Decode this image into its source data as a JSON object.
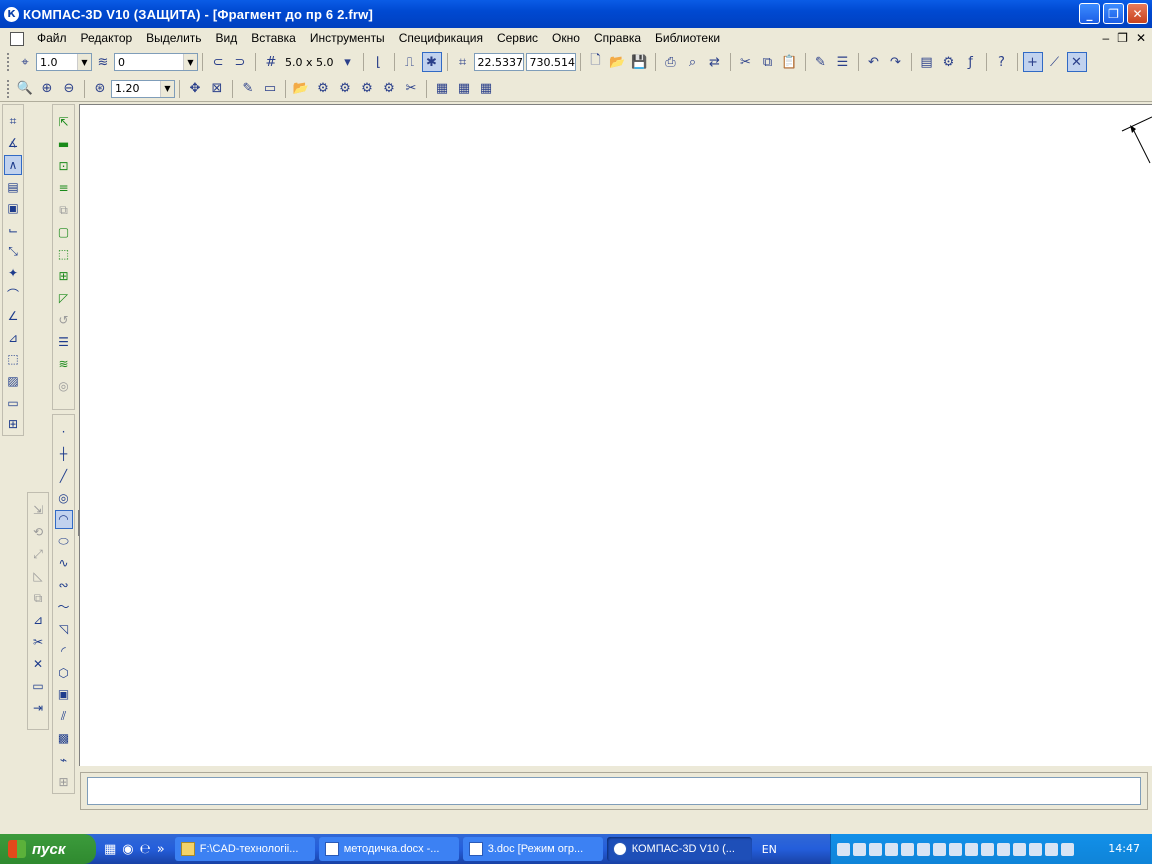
{
  "window": {
    "title": "КОМПАС-3D V10 (ЗАЩИТА) - [Фрагмент до пр 6  2.frw]"
  },
  "menu": [
    "Файл",
    "Редактор",
    "Выделить",
    "Вид",
    "Вставка",
    "Инструменты",
    "Спецификация",
    "Сервис",
    "Окно",
    "Справка",
    "Библиотеки"
  ],
  "toolbar1": {
    "line_scale": "1.0",
    "layer": "0",
    "grid_step": "5.0 x 5.0",
    "coord_x": "22.5337",
    "coord_y": "730.514"
  },
  "toolbar2": {
    "zoom": "1.20"
  },
  "taskbar": {
    "start_label": "пуск",
    "tasks": [
      "F:\\CAD-технологii...",
      "методичка.docx -...",
      "3.doc [Режим огр...",
      "КОМПАС-3D V10 (..."
    ],
    "lang": "EN",
    "clock": "14:47"
  },
  "icons": {
    "flyout": [
      "arc-1",
      "arc-2",
      "arc-3",
      "arc-4",
      "arc-5"
    ]
  }
}
